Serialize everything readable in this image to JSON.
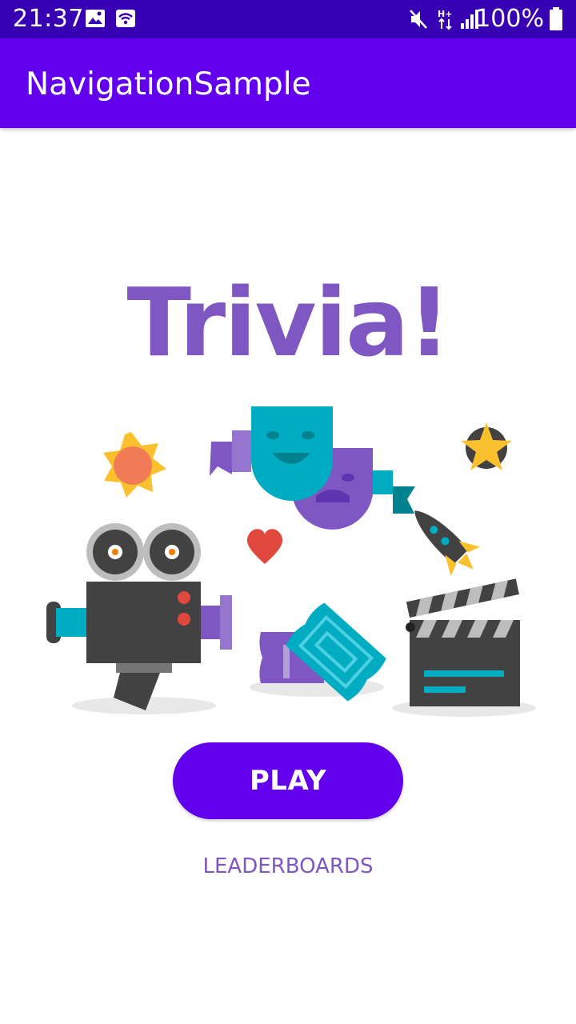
{
  "status_bar": {
    "time": "21:37",
    "battery_text": "100%",
    "icons": [
      "image-icon",
      "wifi-icon",
      "mute-icon",
      "data-icon",
      "signal-icon",
      "battery-icon"
    ]
  },
  "app_bar": {
    "title": "NavigationSample"
  },
  "main": {
    "heading": "Trivia!",
    "illustration_items": [
      "movie-camera-icon",
      "drama-masks-icon",
      "tickets-icon",
      "clapperboard-icon",
      "burst-icon",
      "star-icon",
      "heart-icon",
      "rocket-icon"
    ],
    "play_label": "PLAY",
    "leaderboards_label": "LEADERBOARDS"
  },
  "colors": {
    "status_bar": "#3700b3",
    "app_bar": "#6200ee",
    "accent_purple": "#7e57c2",
    "button": "#6200ee"
  }
}
